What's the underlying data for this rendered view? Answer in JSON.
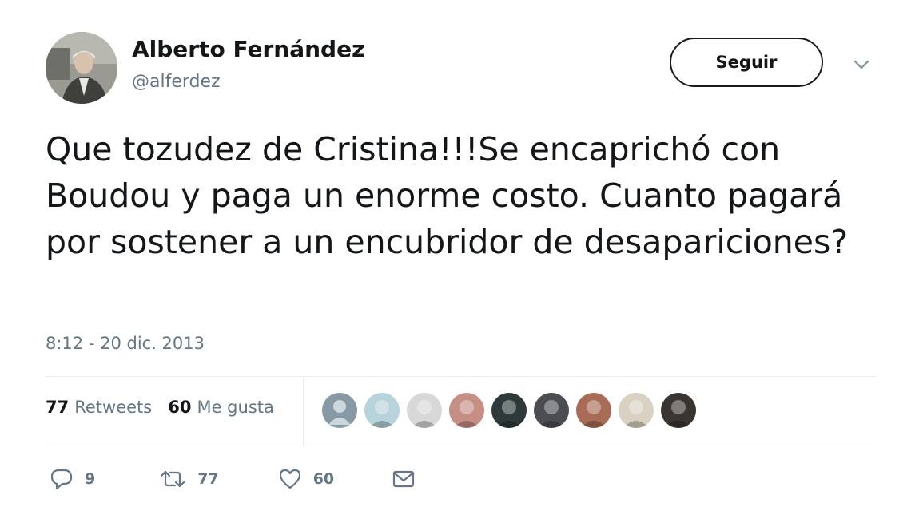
{
  "author": {
    "name": "Alberto Fernández",
    "handle": "@alferdez"
  },
  "follow_button": "Seguir",
  "tweet": {
    "text": "Que tozudez de Cristina!!!Se encaprichó con Boudou y paga un enorme costo. Cuanto pagará por sostener a un encubridor de desapariciones?",
    "timestamp": "8:12 - 20 dic. 2013"
  },
  "stats": {
    "retweets_count": "77",
    "retweets_label": "Retweets",
    "likes_count": "60",
    "likes_label": "Me gusta"
  },
  "liker_avatars": [
    {
      "icon": "default-profile-avatar",
      "color": "#8899a6"
    },
    {
      "icon": "sticker-avatar",
      "color": "#b7d3dc"
    },
    {
      "icon": "cartoon-face-avatar",
      "color": "#d8d8d8"
    },
    {
      "icon": "woman-photo-avatar",
      "color": "#c68f86"
    },
    {
      "icon": "sunglasses-avatar",
      "color": "#2e3a3a"
    },
    {
      "icon": "building-avatar",
      "color": "#4a4d52"
    },
    {
      "icon": "couple-photo-avatar",
      "color": "#a86b55"
    },
    {
      "icon": "statue-avatar",
      "color": "#d9d1c2"
    },
    {
      "icon": "man-photo-avatar",
      "color": "#3b3532"
    }
  ],
  "actions": {
    "reply_count": "9",
    "retweet_count": "77",
    "like_count": "60"
  },
  "colors": {
    "text": "#14171a",
    "secondary": "#657786",
    "divider": "#e6ecf0"
  }
}
